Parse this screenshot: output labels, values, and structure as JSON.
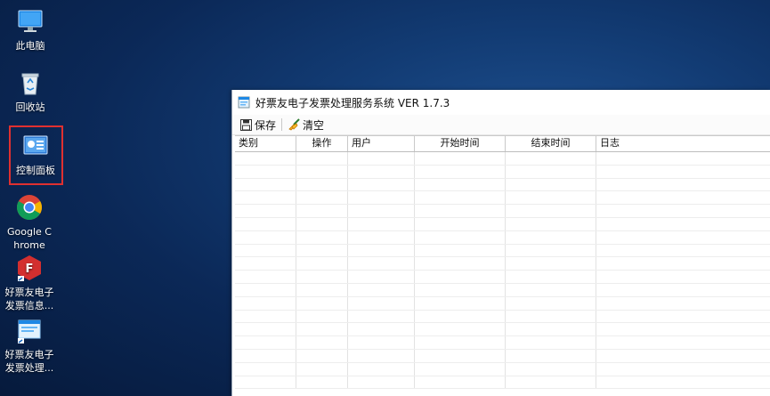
{
  "desktop": {
    "icons": [
      {
        "label": "此电脑"
      },
      {
        "label": "回收站"
      },
      {
        "label": "控制面板"
      },
      {
        "label": "Google Chrome"
      },
      {
        "label": "好票友电子发票信息..."
      },
      {
        "label": "好票友电子发票处理..."
      }
    ]
  },
  "window": {
    "title": "好票友电子发票处理服务系统 VER 1.7.3",
    "toolbar": {
      "save_label": "保存",
      "clear_label": "清空"
    },
    "table": {
      "columns": [
        "类别",
        "操作",
        "用户",
        "开始时间",
        "结束时间",
        "日志"
      ],
      "rows": []
    }
  },
  "colors": {
    "desktop_bg": "#0b2857",
    "selection_border": "#e03030"
  }
}
